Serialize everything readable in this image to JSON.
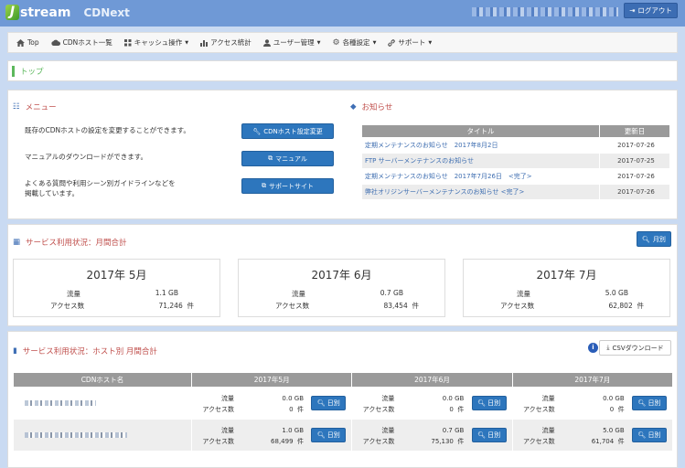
{
  "header": {
    "logo_j": "J",
    "logo_text": "stream",
    "logo_product": "CDNext",
    "logout_label": "ログアウト",
    "colors": {
      "brand": "#6f99d6",
      "button": "#2d76bd"
    }
  },
  "nav": {
    "items": [
      {
        "icon": "home-icon",
        "label": "Top",
        "caret": false
      },
      {
        "icon": "cloud-icon",
        "label": "CDNホスト一覧",
        "caret": false
      },
      {
        "icon": "grid-icon",
        "label": "キャッシュ操作",
        "caret": true
      },
      {
        "icon": "bar-chart-icon",
        "label": "アクセス統計",
        "caret": false
      },
      {
        "icon": "user-icon",
        "label": "ユーザー管理",
        "caret": true
      },
      {
        "icon": "gear-icon",
        "label": "各種設定",
        "caret": true
      },
      {
        "icon": "link-icon",
        "label": "サポート",
        "caret": true
      }
    ]
  },
  "breadcrumb": {
    "title": "トップ"
  },
  "menu": {
    "title": "メニュー",
    "items": [
      {
        "text": "既存のCDNホストの設定を変更することができます。",
        "button": "CDNホスト設定変更"
      },
      {
        "text": "マニュアルのダウンロードができます。",
        "button": "マニュアル"
      },
      {
        "text": "よくある質問や利用シーン別ガイドラインなどを",
        "text2": "掲載しています。",
        "button": "サポートサイト"
      }
    ]
  },
  "news": {
    "title": "お知らせ",
    "col_title": "タイトル",
    "col_date": "更新日",
    "rows": [
      {
        "title": "定期メンテナンスのお知らせ　2017年8月2日",
        "date": "2017-07-26"
      },
      {
        "title": "FTP サーバーメンテナンスのお知らせ",
        "date": "2017-07-25"
      },
      {
        "title": "定期メンテナンスのお知らせ　2017年7月26日　<完了>",
        "date": "2017-07-26"
      },
      {
        "title": "弊社オリジンサーバーメンテナンスのお知らせ <完了>",
        "date": "2017-07-26"
      }
    ]
  },
  "monthly": {
    "title": "サービス利用状況：月間合計",
    "button": "月別",
    "traffic_label": "流量",
    "access_label": "アクセス数",
    "count_unit": "件",
    "months": [
      {
        "title": "2017年 5月",
        "traffic": "1.1 GB",
        "access": "71,246"
      },
      {
        "title": "2017年 6月",
        "traffic": "0.7 GB",
        "access": "83,454"
      },
      {
        "title": "2017年 7月",
        "traffic": "5.0 GB",
        "access": "62,802"
      }
    ]
  },
  "byhost": {
    "title": "サービス利用状況：ホスト別 月間合計",
    "csv_button": "CSVダウンロード",
    "info": "i",
    "col_host": "CDNホスト名",
    "months": [
      "2017年5月",
      "2017年6月",
      "2017年7月"
    ],
    "traffic_label": "流量",
    "access_label": "アクセス数",
    "count_unit": "件",
    "daily_button": "日別",
    "rows": [
      {
        "cells": [
          {
            "traffic": "0.0 GB",
            "access": "0"
          },
          {
            "traffic": "0.0 GB",
            "access": "0"
          },
          {
            "traffic": "0.0 GB",
            "access": "0"
          }
        ]
      },
      {
        "cells": [
          {
            "traffic": "1.0 GB",
            "access": "68,499"
          },
          {
            "traffic": "0.7 GB",
            "access": "75,130"
          },
          {
            "traffic": "5.0 GB",
            "access": "61,704"
          }
        ]
      }
    ]
  }
}
